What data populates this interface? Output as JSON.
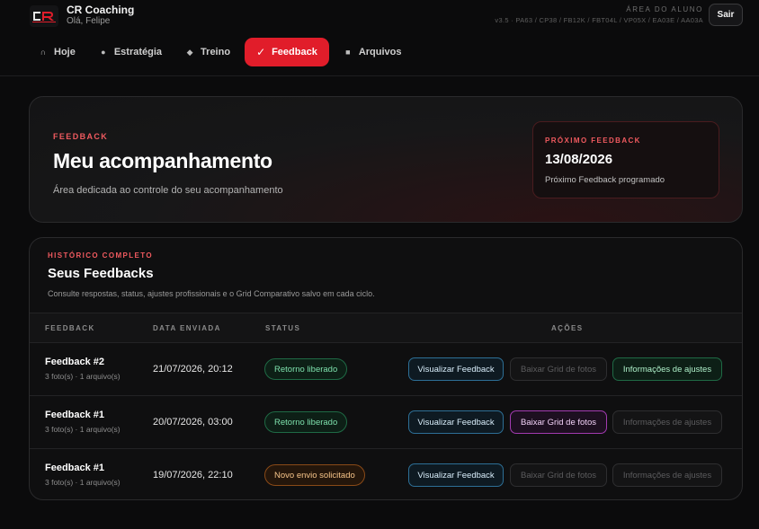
{
  "header": {
    "brand_title": "CR Coaching",
    "greeting": "Olá, Felipe",
    "area_label": "ÁREA DO ALUNO",
    "version": "v3.5 · PA63 / CP38 / FB12K / FBT04L / VP05X / EA03E / AA03A",
    "logout_label": "Sair"
  },
  "nav": [
    {
      "label": "Hoje",
      "icon": "home-icon",
      "glyph": "∩",
      "active": false
    },
    {
      "label": "Estratégia",
      "icon": "target-icon",
      "glyph": "●",
      "active": false
    },
    {
      "label": "Treino",
      "icon": "diamond-icon",
      "glyph": "◆",
      "active": false
    },
    {
      "label": "Feedback",
      "icon": "check-icon",
      "glyph": "✓",
      "active": true
    },
    {
      "label": "Arquivos",
      "icon": "file-icon",
      "glyph": "■",
      "active": false
    }
  ],
  "hero": {
    "kicker": "FEEDBACK",
    "title": "Meu acompanhamento",
    "description": "Área dedicada ao controle do seu acompanhamento",
    "next": {
      "kicker": "PRÓXIMO FEEDBACK",
      "date": "13/08/2026",
      "subtitle": "Próximo Feedback programado"
    }
  },
  "history": {
    "kicker": "HISTÓRICO COMPLETO",
    "title": "Seus Feedbacks",
    "description": "Consulte respostas, status, ajustes profissionais e o Grid Comparativo salvo em cada ciclo.",
    "columns": {
      "feedback": "FEEDBACK",
      "date": "DATA ENVIADA",
      "status": "STATUS",
      "actions": "AÇÕES"
    },
    "rows": [
      {
        "name": "Feedback #2",
        "meta": "3 foto(s) · 1 arquivo(s)",
        "date": "21/07/2026, 20:12",
        "status": "Retorno liberado",
        "status_kind": "ok",
        "view_label": "Visualizar Feedback",
        "grid_label": "Baixar Grid de fotos",
        "grid_enabled": false,
        "info_label": "Informações de ajustes",
        "info_enabled": true
      },
      {
        "name": "Feedback #1",
        "meta": "3 foto(s) · 1 arquivo(s)",
        "date": "20/07/2026, 03:00",
        "status": "Retorno liberado",
        "status_kind": "ok",
        "view_label": "Visualizar Feedback",
        "grid_label": "Baixar Grid de fotos",
        "grid_enabled": true,
        "info_label": "Informações de ajustes",
        "info_enabled": false
      },
      {
        "name": "Feedback #1",
        "meta": "3 foto(s) · 1 arquivo(s)",
        "date": "19/07/2026, 22:10",
        "status": "Novo envio solicitado",
        "status_kind": "warn",
        "view_label": "Visualizar Feedback",
        "grid_label": "Baixar Grid de fotos",
        "grid_enabled": false,
        "info_label": "Informações de ajustes",
        "info_enabled": false
      }
    ]
  },
  "colors": {
    "accent": "#e11d2a",
    "background": "#0b0b0c",
    "ok": "#7ee2ad",
    "warn": "#f6c489",
    "view": "#2d6f96",
    "grid_active": "#a23bb0"
  }
}
